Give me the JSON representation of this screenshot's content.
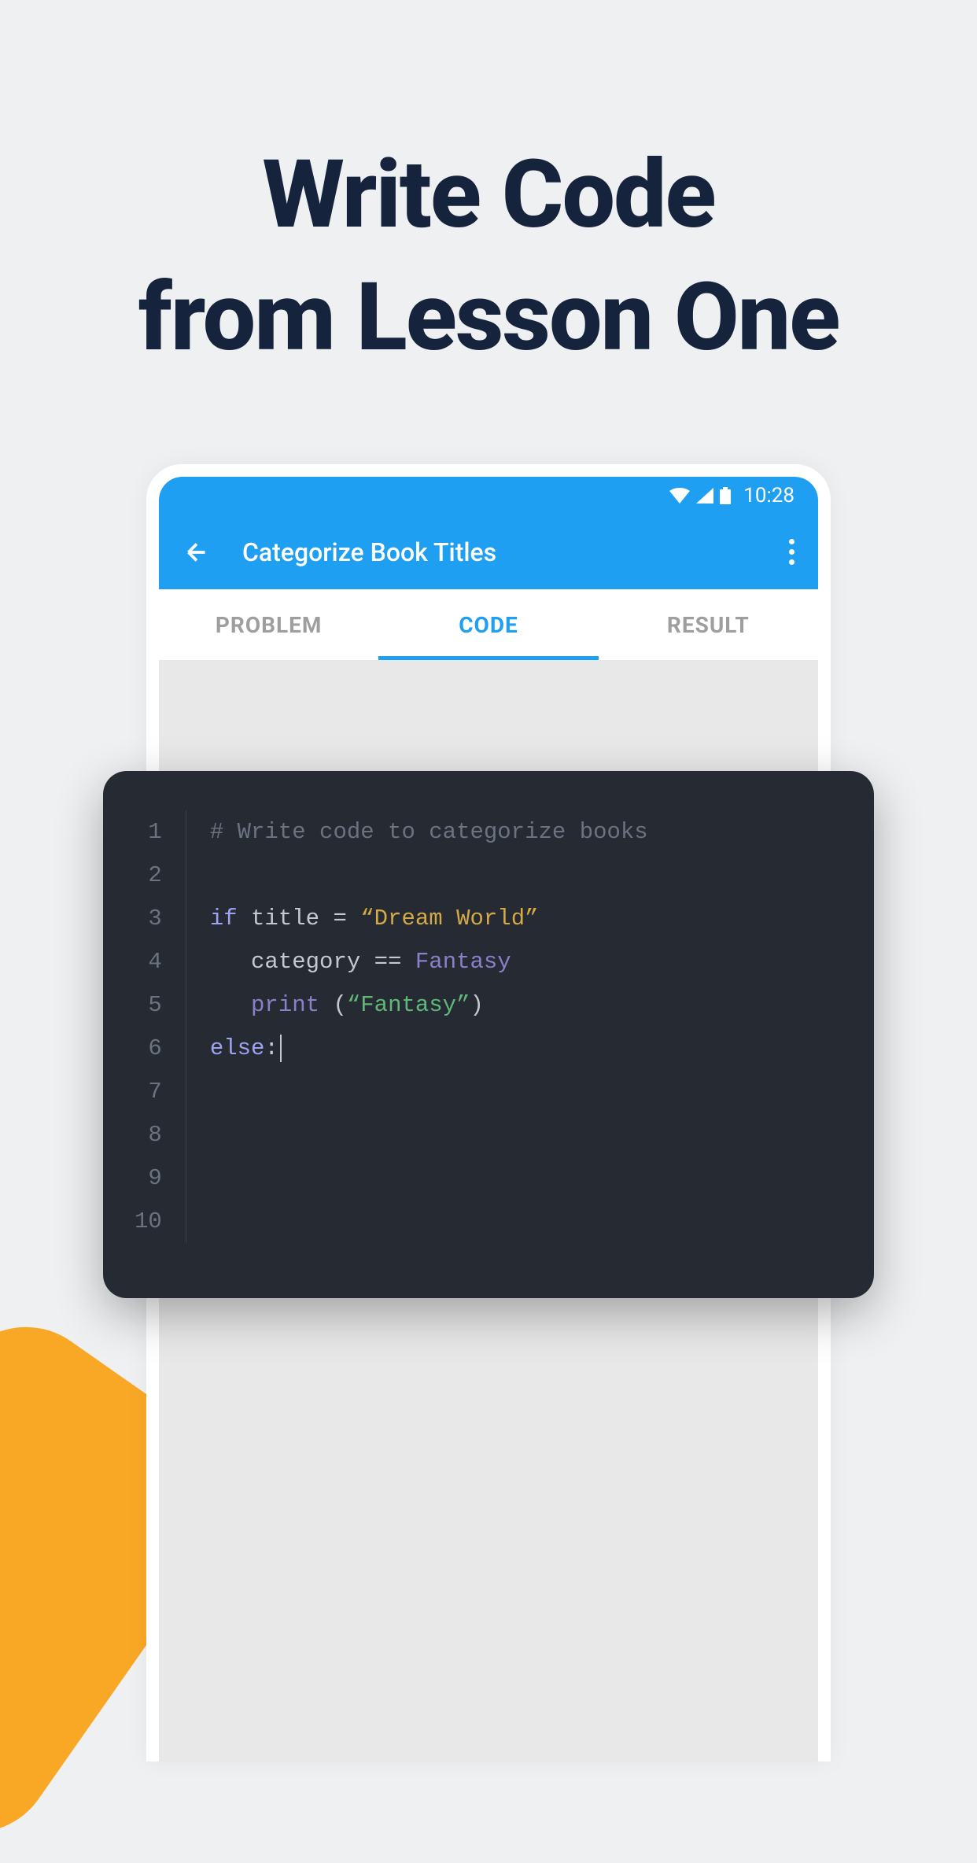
{
  "headline": {
    "line1": "Write Code",
    "line2": "from Lesson One"
  },
  "statusBar": {
    "time": "10:28"
  },
  "appBar": {
    "title": "Categorize Book Titles"
  },
  "tabs": {
    "problem": "PROBLEM",
    "code": "CODE",
    "result": "RESULT"
  },
  "editor": {
    "lineNumbers": [
      "1",
      "2",
      "3",
      "4",
      "5",
      "6",
      "7",
      "8",
      "9",
      "10"
    ],
    "code": {
      "line1": {
        "comment": "# Write code to categorize books"
      },
      "line3": {
        "if": "if",
        "title": "title",
        "eq": "=",
        "str1": "“Dream World”"
      },
      "line4": {
        "category": "category",
        "eqq": "==",
        "fantasy": "Fantasy"
      },
      "line5": {
        "print": "print",
        "open": " (",
        "str": "“Fantasy”",
        "close": ")"
      },
      "line6": {
        "else": "else",
        "colon": ":"
      }
    }
  }
}
